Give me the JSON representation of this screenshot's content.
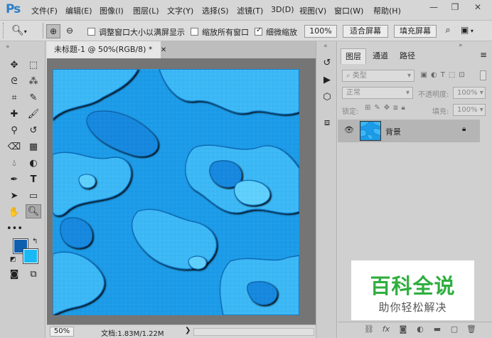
{
  "app": {
    "logo": "Ps",
    "menus": [
      "文件(F)",
      "编辑(E)",
      "图像(I)",
      "图层(L)",
      "文字(Y)",
      "选择(S)",
      "滤镜(T)",
      "3D(D)",
      "视图(V)",
      "窗口(W)",
      "帮助(H)"
    ],
    "window_controls": [
      "minimize-icon",
      "restore-icon",
      "close-icon"
    ]
  },
  "options": {
    "resize_windows_label": "调整窗口大小以满屏显示",
    "resize_windows_checked": false,
    "zoom_all_label": "缩放所有窗口",
    "zoom_all_checked": false,
    "scrubby_zoom_label": "细微缩放",
    "scrubby_zoom_checked": true,
    "zoom_100": "100%",
    "fit_screen": "适合屏幕",
    "fill_screen": "填充屏幕"
  },
  "document": {
    "tab_title": "未标题-1 @ 50%(RGB/8) *",
    "zoom": "50%",
    "doc_info": "文档:1.83M/1.22M",
    "colors": {
      "foreground": "#0f5fae",
      "background": "#19b9f5",
      "texture_base": "#1c9be8"
    }
  },
  "layers_panel": {
    "tabs": [
      "图层",
      "通道",
      "路径"
    ],
    "filter_kind": "类型",
    "blend_mode": "正常",
    "opacity_label": "不透明度:",
    "opacity_value": "100%",
    "lock_label": "锁定:",
    "fill_label": "填充:",
    "fill_value": "100%",
    "layers": [
      {
        "name": "背景",
        "visible": true,
        "locked": true
      }
    ],
    "footer_icons": [
      "link-icon",
      "fx-icon",
      "mask-icon",
      "adjustment-icon",
      "group-icon",
      "new-layer-icon",
      "trash-icon"
    ]
  },
  "watermark": {
    "title": "百科全说",
    "subtitle": "助你轻松解决"
  }
}
